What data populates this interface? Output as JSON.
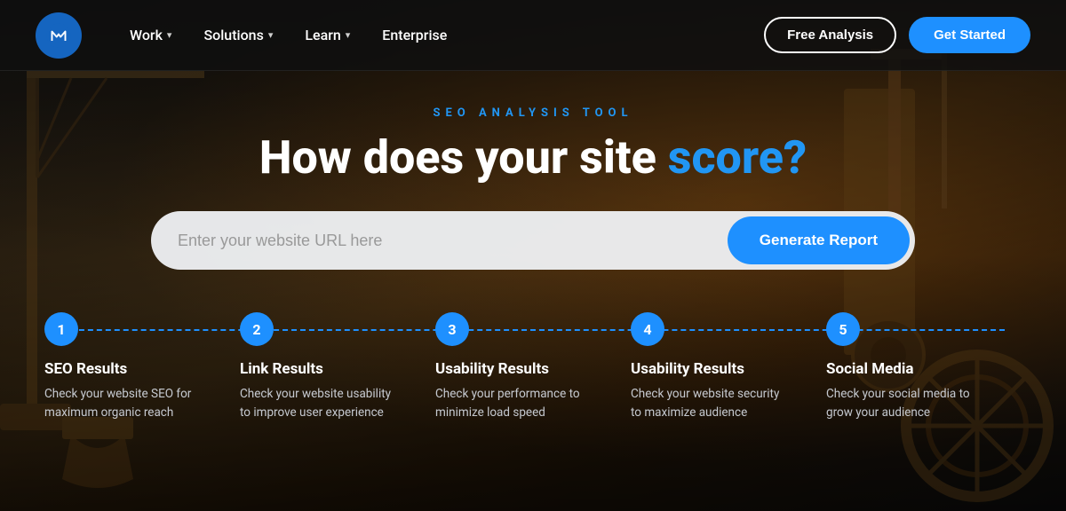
{
  "nav": {
    "work_label": "Work",
    "solutions_label": "Solutions",
    "learn_label": "Learn",
    "enterprise_label": "Enterprise",
    "free_analysis_label": "Free Analysis",
    "get_started_label": "Get Started"
  },
  "hero": {
    "subtitle": "SEO ANALYSIS TOOL",
    "title_part1": "How does your site ",
    "title_accent": "score?",
    "search_placeholder": "Enter your website URL here",
    "generate_btn": "Generate Report"
  },
  "steps": [
    {
      "number": "1",
      "title": "SEO Results",
      "desc": "Check your website SEO for maximum organic reach"
    },
    {
      "number": "2",
      "title": "Link Results",
      "desc": "Check your website usability to improve user experience"
    },
    {
      "number": "3",
      "title": "Usability Results",
      "desc": "Check your performance to minimize load speed"
    },
    {
      "number": "4",
      "title": "Usability Results",
      "desc": "Check your website security to maximize audience"
    },
    {
      "number": "5",
      "title": "Social Media",
      "desc": "Check your social media to grow your audience"
    }
  ],
  "colors": {
    "accent": "#1e90ff",
    "dark": "#1a1a1a"
  }
}
